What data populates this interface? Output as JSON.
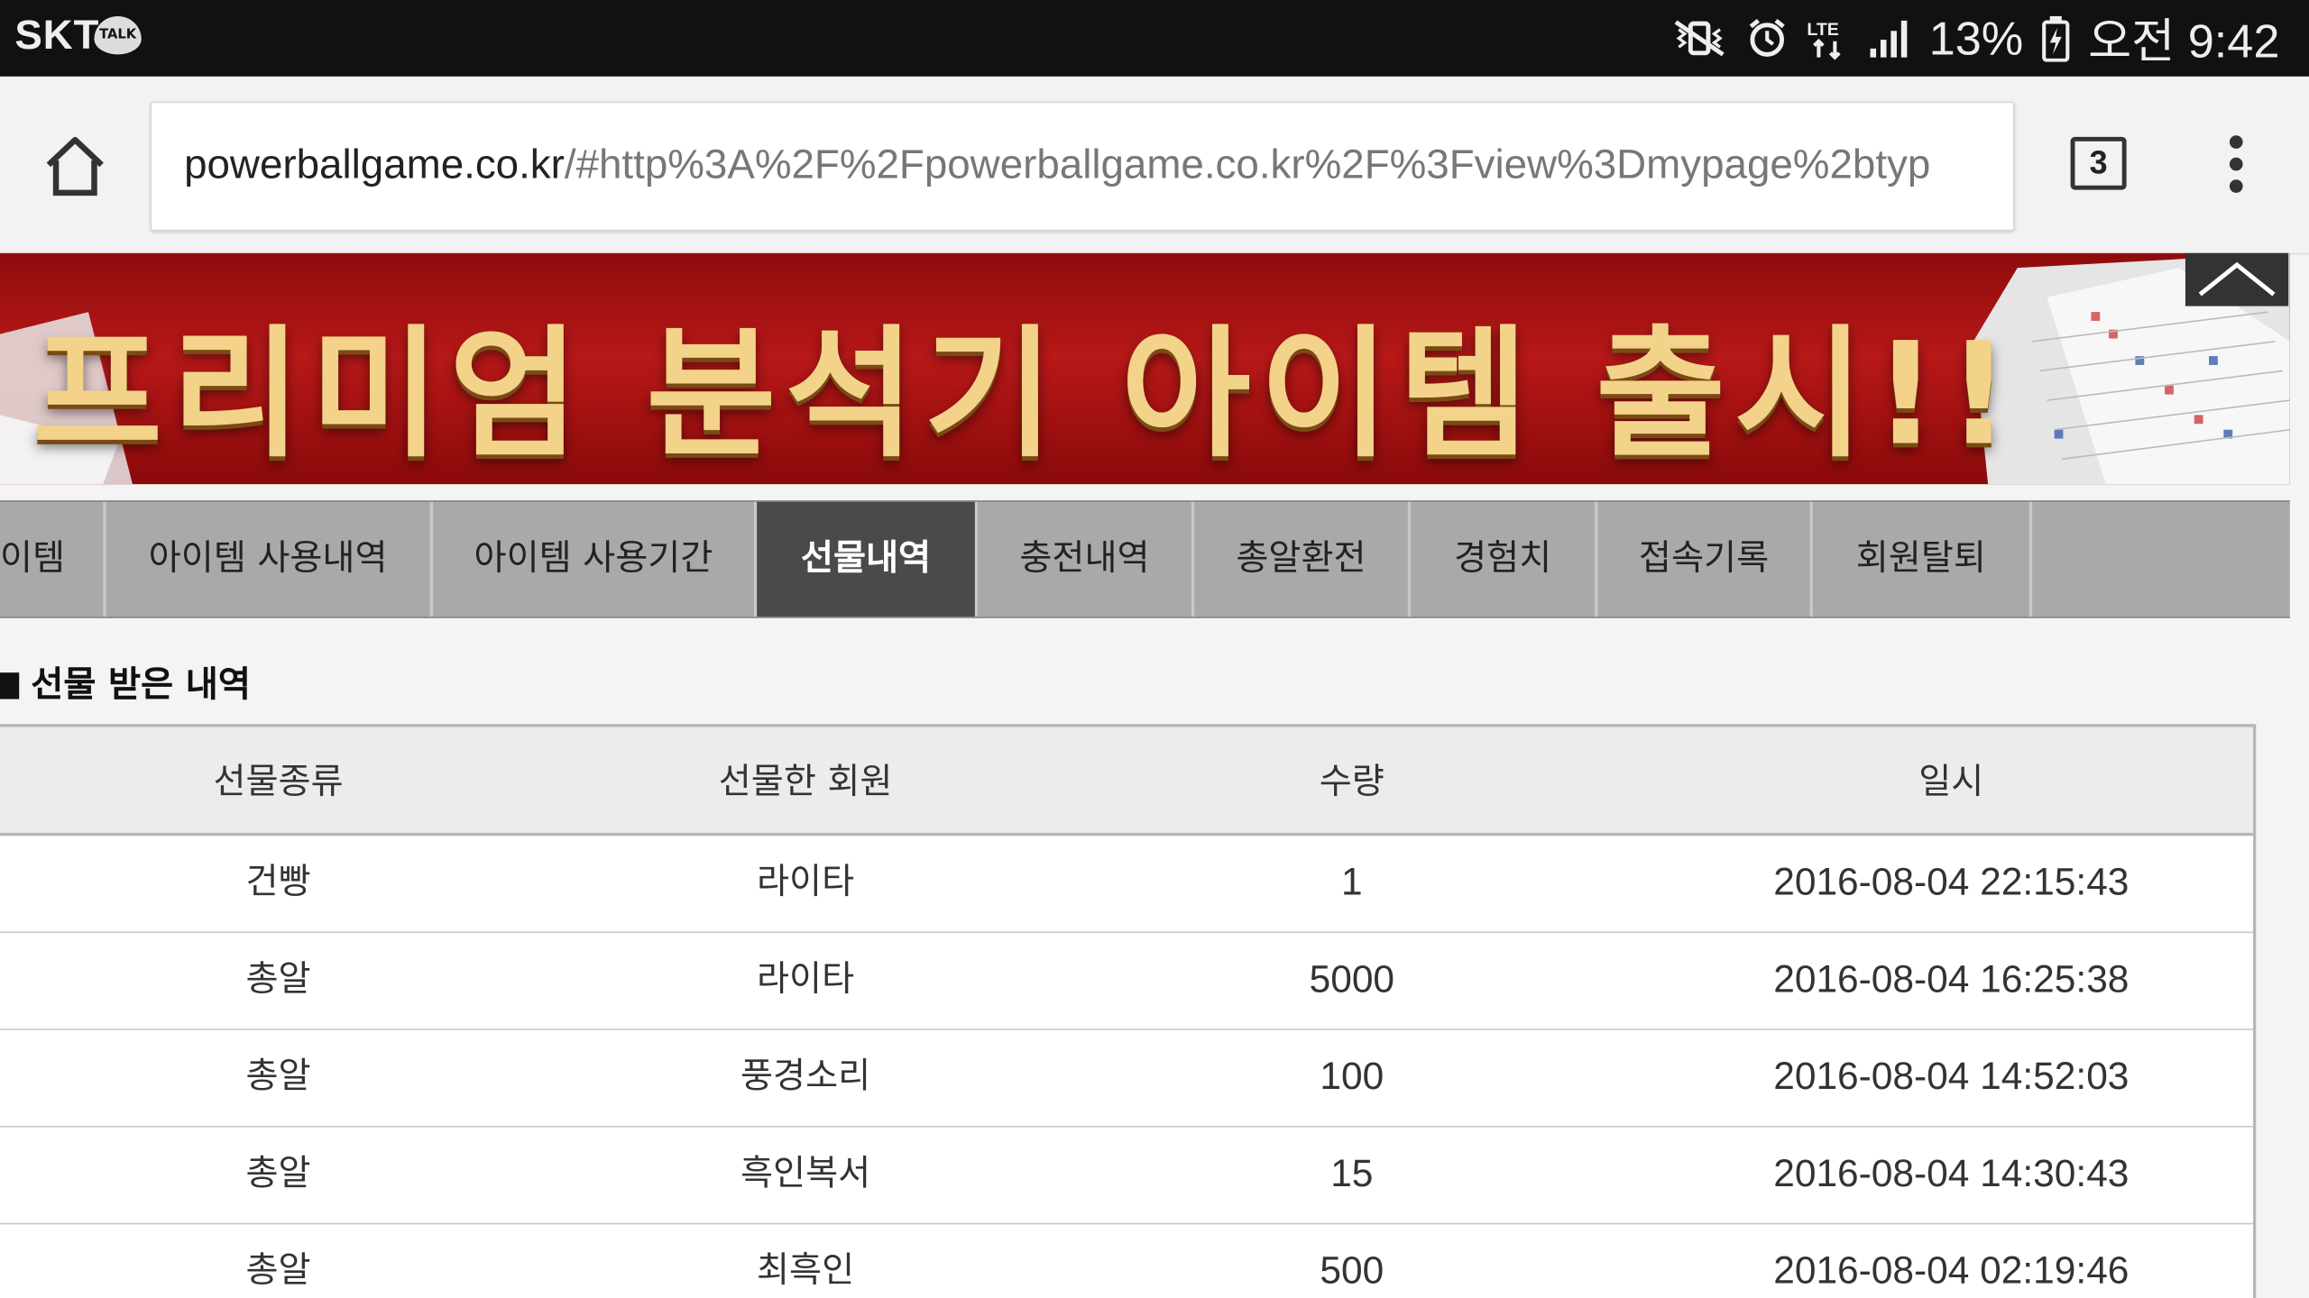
{
  "status_bar": {
    "carrier": "SKT",
    "talk_badge": "TALK",
    "battery": "13%",
    "time": "오전 9:42",
    "icons": [
      "mute-vibrate-icon",
      "alarm-icon",
      "lte-icon",
      "signal-icon",
      "battery-icon"
    ]
  },
  "browser": {
    "url_host": "powerballgame.co.kr",
    "url_rest": "/#http%3A%2F%2Fpowerballgame.co.kr%2F%3Fview%3Dmypage%2btyp",
    "tab_count": "3"
  },
  "banner": {
    "text": "프리미엄 분석기 아이템 출시!!"
  },
  "nav": {
    "items": [
      {
        "label": "이템",
        "active": false
      },
      {
        "label": "아이템 사용내역",
        "active": false
      },
      {
        "label": "아이템 사용기간",
        "active": false
      },
      {
        "label": "선물내역",
        "active": true
      },
      {
        "label": "충전내역",
        "active": false
      },
      {
        "label": "총알환전",
        "active": false
      },
      {
        "label": "경험치",
        "active": false
      },
      {
        "label": "접속기록",
        "active": false
      },
      {
        "label": "회원탈퇴",
        "active": false
      }
    ]
  },
  "section": {
    "title": "선물 받은 내역"
  },
  "table": {
    "headers": [
      "선물종류",
      "선물한 회원",
      "수량",
      "일시"
    ],
    "rows": [
      [
        "건빵",
        "라이타",
        "1",
        "2016-08-04 22:15:43"
      ],
      [
        "총알",
        "라이타",
        "5000",
        "2016-08-04 16:25:38"
      ],
      [
        "총알",
        "풍경소리",
        "100",
        "2016-08-04 14:52:03"
      ],
      [
        "총알",
        "흑인복서",
        "15",
        "2016-08-04 14:30:43"
      ],
      [
        "총알",
        "최흑인",
        "500",
        "2016-08-04 02:19:46"
      ]
    ]
  },
  "colors": {
    "nav_bg": "#a9a9a9",
    "nav_active": "#4a4a4a",
    "banner_red": "#b81818",
    "banner_gold": "#f2d389"
  }
}
